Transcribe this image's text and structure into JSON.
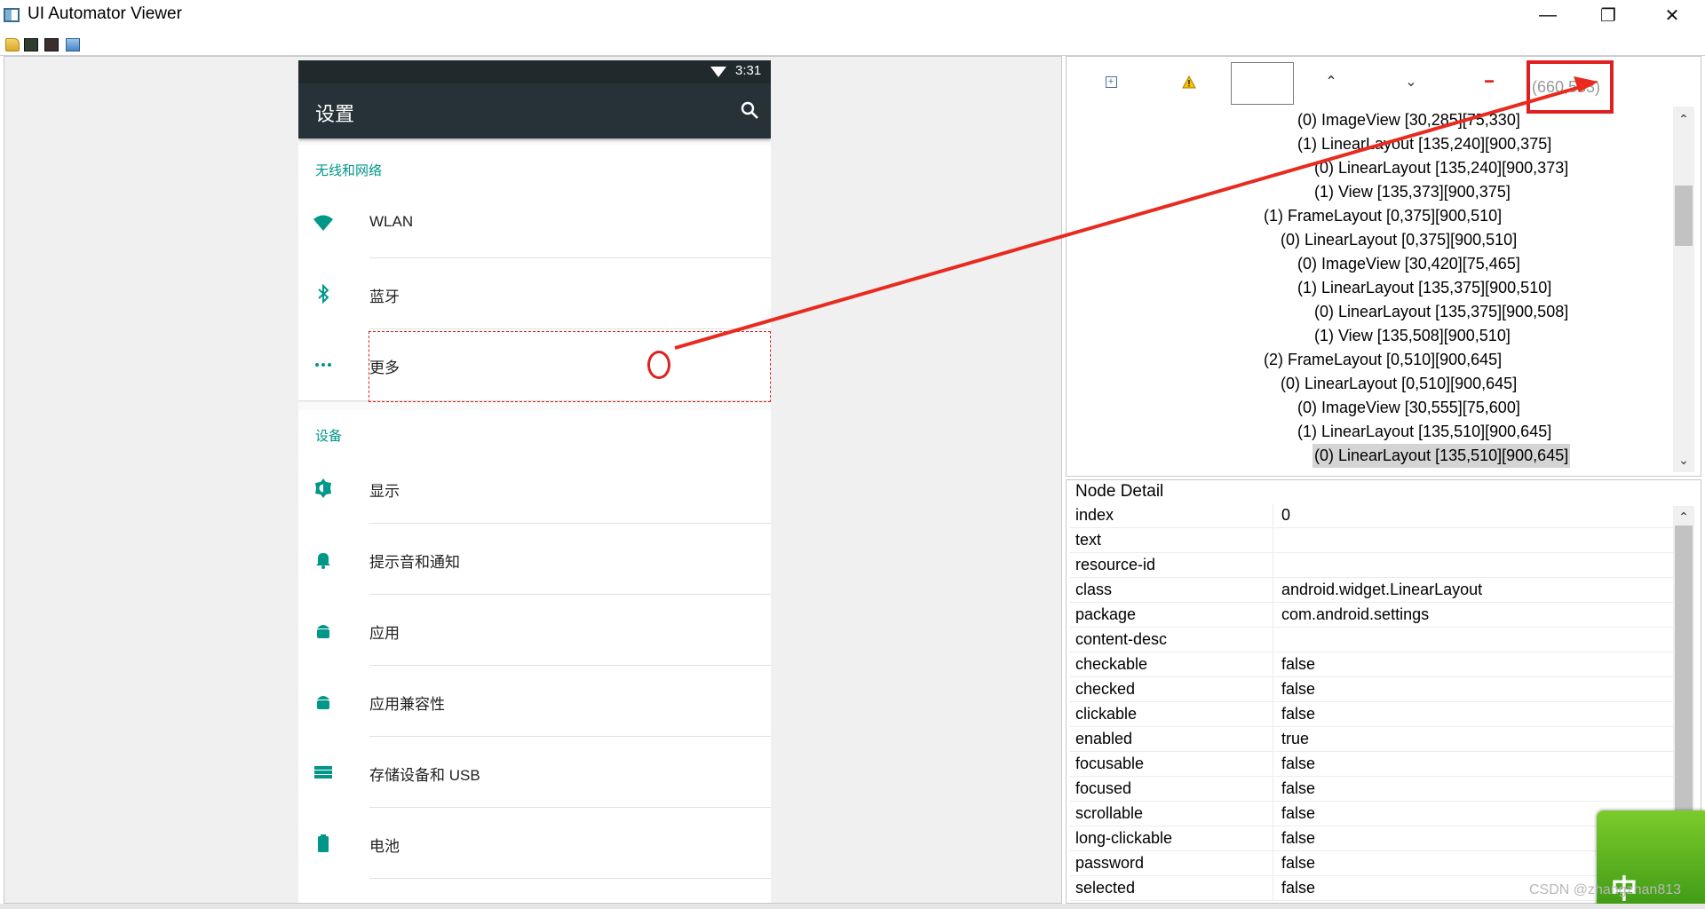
{
  "window": {
    "title": "UI Automator Viewer",
    "minimize_glyph": "—",
    "maximize_glyph": "❐",
    "close_glyph": "✕"
  },
  "toolbar": {
    "icons": [
      "open-folder-icon",
      "device-screenshot-icon",
      "device-screenshot-compressed-icon",
      "save-icon"
    ]
  },
  "device": {
    "status_time": "3:31",
    "app_title": "设置",
    "sections": [
      {
        "header": "无线和网络",
        "items": [
          {
            "label": "WLAN",
            "icon": "wifi-icon"
          },
          {
            "label": "蓝牙",
            "icon": "bluetooth-icon"
          },
          {
            "label": "更多",
            "icon": "more-dots-icon"
          }
        ]
      },
      {
        "header": "设备",
        "items": [
          {
            "label": "显示",
            "icon": "brightness-icon"
          },
          {
            "label": "提示音和通知",
            "icon": "bell-icon"
          },
          {
            "label": "应用",
            "icon": "android-icon"
          },
          {
            "label": "应用兼容性",
            "icon": "android-icon"
          },
          {
            "label": "存储设备和 USB",
            "icon": "storage-icon"
          },
          {
            "label": "电池",
            "icon": "battery-icon"
          }
        ]
      }
    ]
  },
  "hierarchy": {
    "coordinates": "(660,533)",
    "nodes": [
      {
        "text": "(0) ImageView [30,285][75,330]",
        "depth": 3,
        "selected": false
      },
      {
        "text": "(1) LinearLayout [135,240][900,375]",
        "depth": 3,
        "selected": false
      },
      {
        "text": "(0) LinearLayout [135,240][900,373]",
        "depth": 4,
        "selected": false
      },
      {
        "text": "(1) View [135,373][900,375]",
        "depth": 4,
        "selected": false
      },
      {
        "text": "(1) FrameLayout [0,375][900,510]",
        "depth": 1,
        "selected": false
      },
      {
        "text": "(0) LinearLayout [0,375][900,510]",
        "depth": 2,
        "selected": false
      },
      {
        "text": "(0) ImageView [30,420][75,465]",
        "depth": 3,
        "selected": false
      },
      {
        "text": "(1) LinearLayout [135,375][900,510]",
        "depth": 3,
        "selected": false
      },
      {
        "text": "(0) LinearLayout [135,375][900,508]",
        "depth": 4,
        "selected": false
      },
      {
        "text": "(1) View [135,508][900,510]",
        "depth": 4,
        "selected": false
      },
      {
        "text": "(2) FrameLayout [0,510][900,645]",
        "depth": 1,
        "selected": false
      },
      {
        "text": "(0) LinearLayout [0,510][900,645]",
        "depth": 2,
        "selected": false
      },
      {
        "text": "(0) ImageView [30,555][75,600]",
        "depth": 3,
        "selected": false
      },
      {
        "text": "(1) LinearLayout [135,510][900,645]",
        "depth": 3,
        "selected": false
      },
      {
        "text": "(0) LinearLayout [135,510][900,645]",
        "depth": 4,
        "selected": true
      }
    ]
  },
  "node_detail": {
    "title": "Node Detail",
    "rows": [
      {
        "key": "index",
        "value": "0"
      },
      {
        "key": "text",
        "value": ""
      },
      {
        "key": "resource-id",
        "value": ""
      },
      {
        "key": "class",
        "value": "android.widget.LinearLayout"
      },
      {
        "key": "package",
        "value": "com.android.settings"
      },
      {
        "key": "content-desc",
        "value": ""
      },
      {
        "key": "checkable",
        "value": "false"
      },
      {
        "key": "checked",
        "value": "false"
      },
      {
        "key": "clickable",
        "value": "false"
      },
      {
        "key": "enabled",
        "value": "true"
      },
      {
        "key": "focusable",
        "value": "false"
      },
      {
        "key": "focused",
        "value": "false"
      },
      {
        "key": "scrollable",
        "value": "false"
      },
      {
        "key": "long-clickable",
        "value": "false"
      },
      {
        "key": "password",
        "value": "false"
      },
      {
        "key": "selected",
        "value": "false"
      }
    ]
  },
  "ime": {
    "label": "中"
  },
  "watermark": "CSDN @zhangzhan813",
  "colors": {
    "accent": "#009688",
    "highlight": "#e02020",
    "appbar": "#263238",
    "statusbar": "#20292c"
  }
}
